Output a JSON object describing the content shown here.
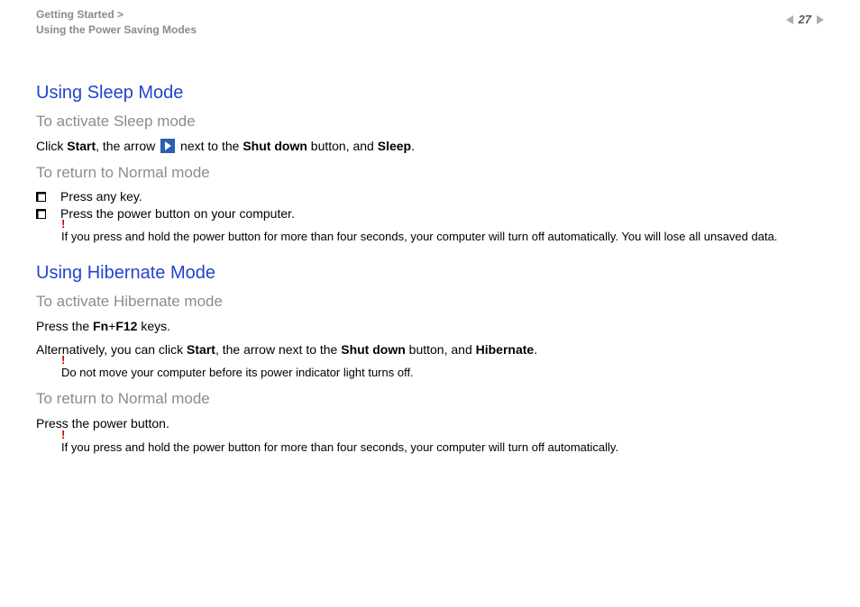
{
  "header": {
    "breadcrumb_line1": "Getting Started >",
    "breadcrumb_line2": "Using the Power Saving Modes",
    "page_number": "27"
  },
  "section1": {
    "title": "Using Sleep Mode",
    "sub1": "To activate Sleep mode",
    "para1_a": "Click ",
    "para1_b": "Start",
    "para1_c": ", the arrow ",
    "para1_d": " next to the ",
    "para1_e": "Shut down",
    "para1_f": " button, and ",
    "para1_g": "Sleep",
    "para1_h": ".",
    "sub2": "To return to Normal mode",
    "bullet1": "Press any key.",
    "bullet2": "Press the power button on your computer.",
    "note_bang": "!",
    "note1": "If you press and hold the power button for more than four seconds, your computer will turn off automatically. You will lose all unsaved data."
  },
  "section2": {
    "title": "Using Hibernate Mode",
    "sub1": "To activate Hibernate mode",
    "para1_a": "Press the ",
    "para1_b": "Fn",
    "para1_c": "+",
    "para1_d": "F12",
    "para1_e": " keys.",
    "para2_a": "Alternatively, you can click ",
    "para2_b": "Start",
    "para2_c": ", the arrow next to the ",
    "para2_d": "Shut down",
    "para2_e": " button, and ",
    "para2_f": "Hibernate",
    "para2_g": ".",
    "note_bang1": "!",
    "note1": "Do not move your computer before its power indicator light turns off.",
    "sub2": "To return to Normal mode",
    "para3": "Press the power button.",
    "note_bang2": "!",
    "note2": "If you press and hold the power button for more than four seconds, your computer will turn off automatically."
  }
}
